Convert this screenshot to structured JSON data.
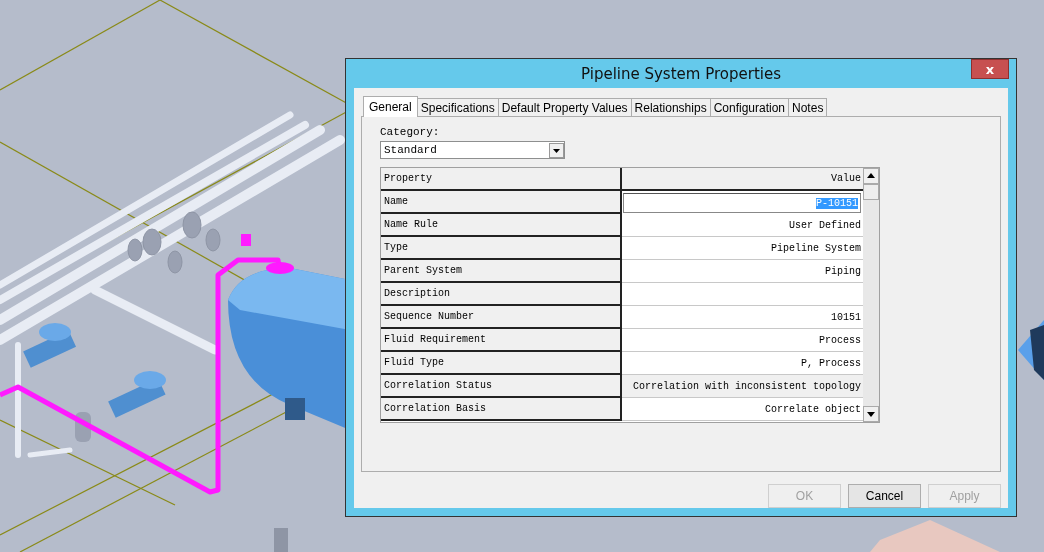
{
  "viewport": {
    "kind": "cad-model"
  },
  "dialog": {
    "title": "Pipeline System Properties",
    "close": "x",
    "tabs": [
      {
        "label": "General",
        "selected": true
      },
      {
        "label": "Specifications",
        "selected": false
      },
      {
        "label": "Default Property Values",
        "selected": false
      },
      {
        "label": "Relationships",
        "selected": false
      },
      {
        "label": "Configuration",
        "selected": false
      },
      {
        "label": "Notes",
        "selected": false
      }
    ],
    "category": {
      "label": "Category:",
      "value": "Standard"
    },
    "grid": {
      "columns": [
        "Property",
        "Value"
      ],
      "rows": [
        {
          "property": "Name",
          "value": "P-10151",
          "kind": "input",
          "selected": true
        },
        {
          "property": "Name Rule",
          "value": "User Defined",
          "kind": "text"
        },
        {
          "property": "Type",
          "value": "Pipeline System",
          "kind": "text"
        },
        {
          "property": "Parent System",
          "value": "Piping",
          "kind": "text"
        },
        {
          "property": "Description",
          "kind": "text"
        },
        {
          "property": "Sequence Number",
          "value": "10151",
          "kind": "text"
        },
        {
          "property": "Fluid Requirement",
          "value": "Process",
          "kind": "text"
        },
        {
          "property": "Fluid Type",
          "value": "P, Process",
          "kind": "text"
        },
        {
          "property": "Correlation Status",
          "value": "Correlation with inconsistent topology",
          "kind": "readonly"
        },
        {
          "property": "Correlation Basis",
          "value": "Correlate object",
          "kind": "text"
        }
      ]
    },
    "buttons": [
      {
        "label": "OK",
        "disabled": true
      },
      {
        "label": "Cancel",
        "disabled": false
      },
      {
        "label": "Apply",
        "disabled": true
      }
    ]
  }
}
